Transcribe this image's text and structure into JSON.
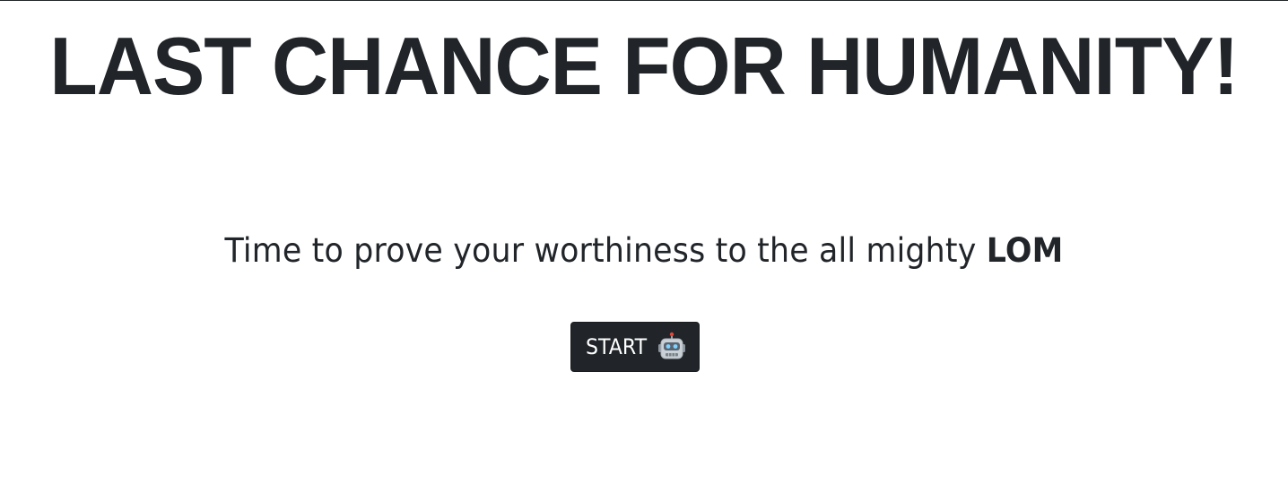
{
  "header": {
    "title": "LAST CHANCE FOR HUMANITY!"
  },
  "main": {
    "tagline": "Time to prove your worthiness to the all mighty",
    "tagline_emphasis": "LOM",
    "start_button": {
      "label": "START",
      "icon": "robot-icon"
    }
  },
  "colors": {
    "text": "#212529",
    "button_bg": "#212529",
    "button_text": "#ffffff",
    "background": "#ffffff"
  }
}
